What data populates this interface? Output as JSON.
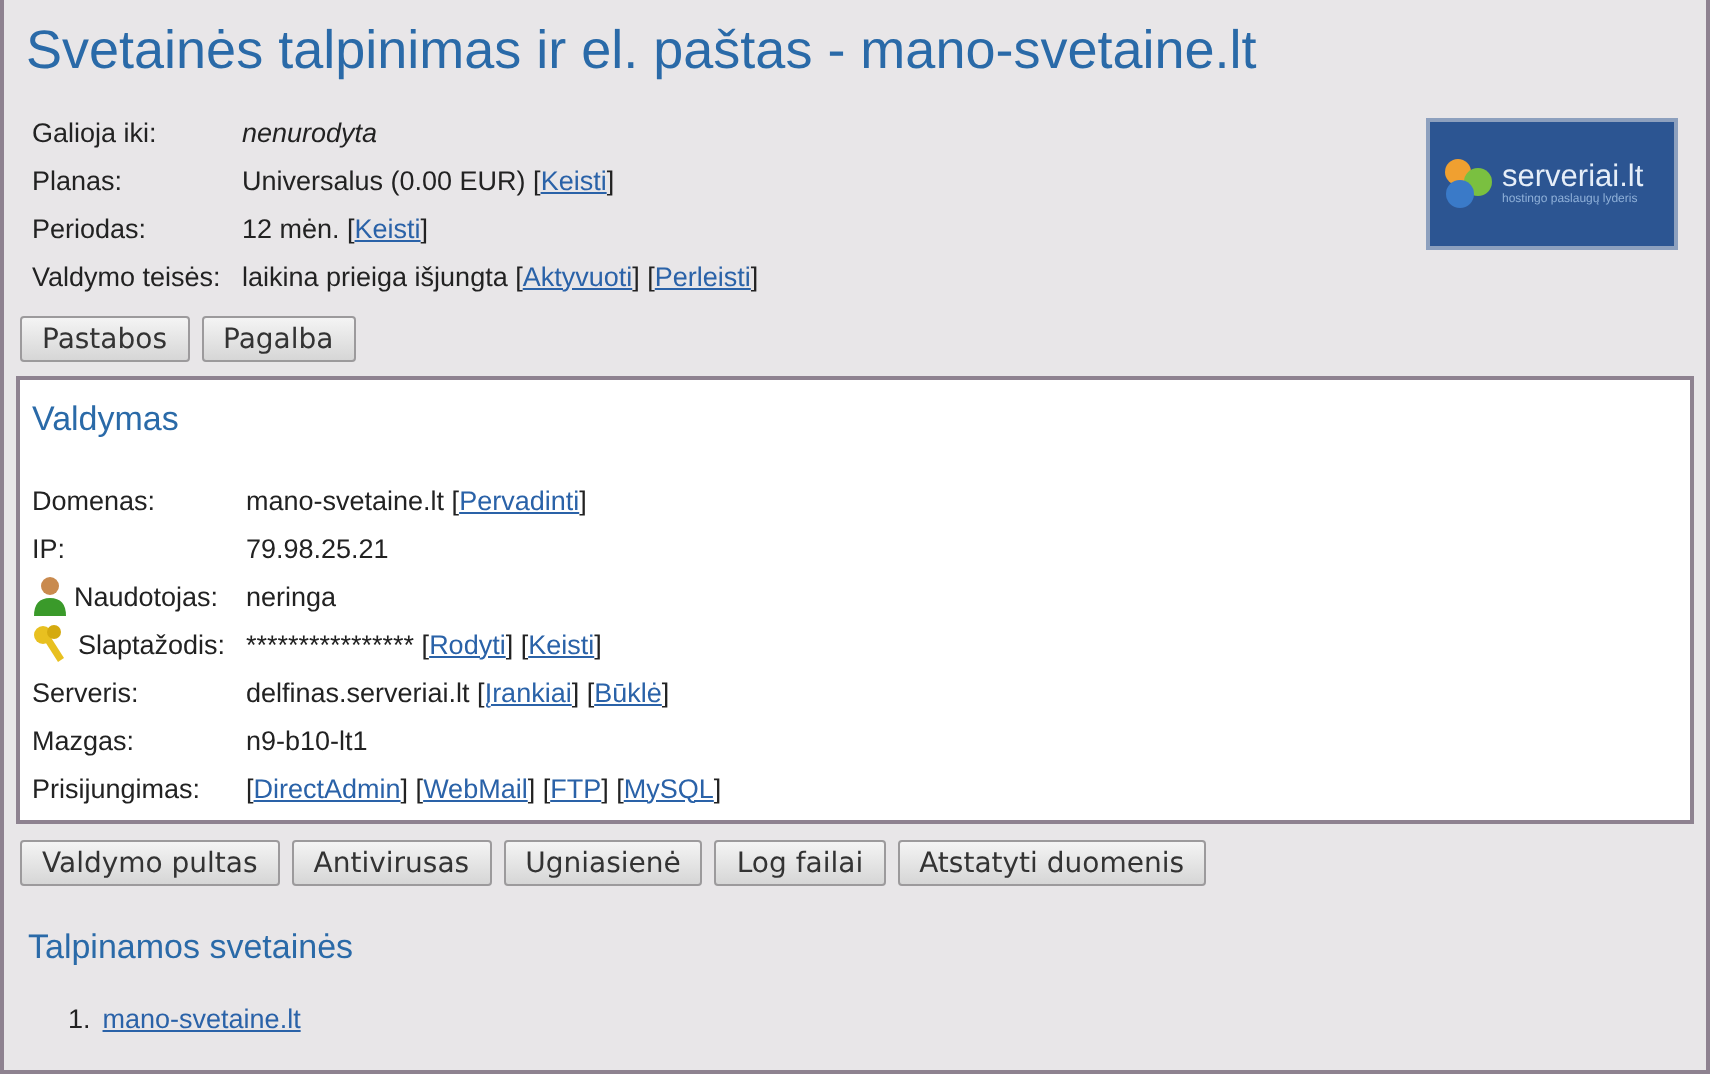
{
  "title": "Svetainės talpinimas ir el. paštas - mano-svetaine.lt",
  "logo": {
    "name": "serveriai.lt",
    "tagline": "hostingo paslaugų lyderis"
  },
  "info": [
    {
      "label": "Galioja iki:",
      "parts": [
        {
          "kind": "em",
          "text": "nenurodyta"
        }
      ]
    },
    {
      "label": "Planas:",
      "parts": [
        {
          "kind": "text",
          "text": "Universalus (0.00 EUR) ["
        },
        {
          "kind": "link",
          "text": "Keisti"
        },
        {
          "kind": "text",
          "text": "]"
        }
      ]
    },
    {
      "label": "Periodas:",
      "parts": [
        {
          "kind": "text",
          "text": "12 mėn. ["
        },
        {
          "kind": "link",
          "text": "Keisti"
        },
        {
          "kind": "text",
          "text": "]"
        }
      ]
    },
    {
      "label": "Valdymo teisės:",
      "parts": [
        {
          "kind": "text",
          "text": "laikina prieiga išjungta ["
        },
        {
          "kind": "link",
          "text": "Aktyvuoti"
        },
        {
          "kind": "text",
          "text": "] ["
        },
        {
          "kind": "link",
          "text": "Perleisti"
        },
        {
          "kind": "text",
          "text": "]"
        }
      ]
    }
  ],
  "top_buttons": [
    "Pastabos",
    "Pagalba"
  ],
  "panel": {
    "heading": "Valdymas",
    "rows": [
      {
        "label": "Domenas:",
        "parts": [
          {
            "kind": "text",
            "text": "mano-svetaine.lt ["
          },
          {
            "kind": "link",
            "text": "Pervadinti"
          },
          {
            "kind": "text",
            "text": "]"
          }
        ]
      },
      {
        "label": "IP:",
        "parts": [
          {
            "kind": "text",
            "text": "79.98.25.21"
          }
        ]
      },
      {
        "label": "Naudotojas:",
        "kind": "user",
        "parts": [
          {
            "kind": "text",
            "text": "neringa"
          }
        ]
      },
      {
        "label": "Slaptažodis:",
        "kind": "key",
        "parts": [
          {
            "kind": "text",
            "text": "**************** ["
          },
          {
            "kind": "link",
            "text": "Rodyti"
          },
          {
            "kind": "text",
            "text": "] ["
          },
          {
            "kind": "link",
            "text": "Keisti"
          },
          {
            "kind": "text",
            "text": "]"
          }
        ]
      },
      {
        "label": "Serveris:",
        "parts": [
          {
            "kind": "text",
            "text": "delfinas.serveriai.lt ["
          },
          {
            "kind": "link",
            "text": "Įrankiai"
          },
          {
            "kind": "text",
            "text": "] ["
          },
          {
            "kind": "link",
            "text": "Būklė"
          },
          {
            "kind": "text",
            "text": "]"
          }
        ]
      },
      {
        "label": "Mazgas:",
        "parts": [
          {
            "kind": "text",
            "text": "n9-b10-lt1"
          }
        ]
      },
      {
        "label": "Prisijungimas:",
        "parts": [
          {
            "kind": "text",
            "text": "["
          },
          {
            "kind": "link",
            "text": "DirectAdmin"
          },
          {
            "kind": "text",
            "text": "] ["
          },
          {
            "kind": "link",
            "text": "WebMail"
          },
          {
            "kind": "text",
            "text": "] ["
          },
          {
            "kind": "link",
            "text": "FTP"
          },
          {
            "kind": "text",
            "text": "] ["
          },
          {
            "kind": "link",
            "text": "MySQL"
          },
          {
            "kind": "text",
            "text": "]"
          }
        ]
      }
    ]
  },
  "panel_buttons": [
    "Valdymo pultas",
    "Antivirusas",
    "Ugniasienė",
    "Log failai",
    "Atstatyti duomenis"
  ],
  "sites": {
    "heading": "Talpinamos svetainės",
    "items": [
      {
        "number": "1.",
        "link": "mano-svetaine.lt"
      }
    ]
  }
}
